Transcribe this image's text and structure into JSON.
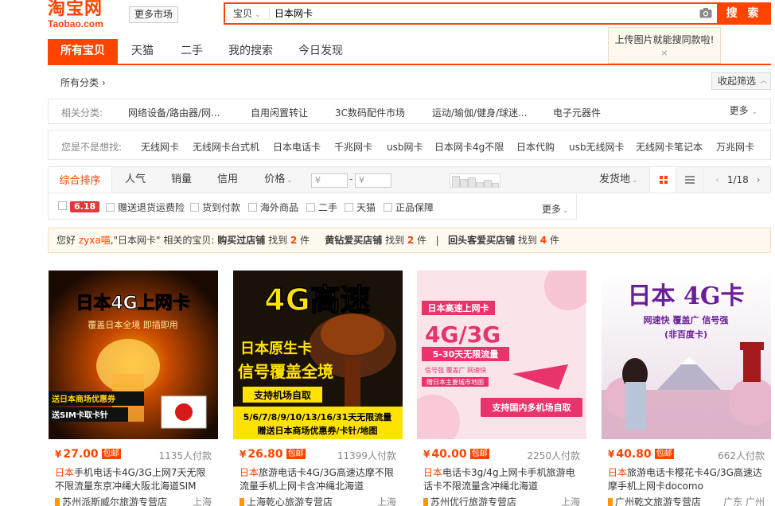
{
  "header": {
    "logo_cn": "淘宝网",
    "logo_en": "Taobao.com",
    "more_market": "更多市场",
    "search_type": "宝贝",
    "search_value": "日本网卡",
    "search_button": "搜 索",
    "tip_text": "上传图片就能搜同款啦!",
    "tip_close": "×"
  },
  "tabs": [
    "所有宝贝",
    "天猫",
    "二手",
    "我的搜索",
    "今日发现"
  ],
  "crumb": {
    "all_categories": "所有分类 ›",
    "collapse": "收起筛选"
  },
  "related": {
    "label": "相关分类:",
    "items": [
      "网络设备/路由器/网...",
      "自用闲置转让",
      "3C数码配件市场",
      "运动/瑜伽/健身/球迷...",
      "电子元器件"
    ],
    "more": "更多"
  },
  "suggest": {
    "label": "您是不是想找:",
    "items": [
      "无线网卡",
      "无线网卡台式机",
      "日本电话卡",
      "千兆网卡",
      "usb网卡",
      "日本网卡4g不限",
      "日本代购",
      "usb无线网卡",
      "无线网卡笔记本",
      "万兆网卡"
    ]
  },
  "sortbar": {
    "sorts": [
      "综合排序",
      "人气",
      "销量",
      "信用",
      "价格"
    ],
    "price_from": "¥",
    "price_to": "¥",
    "price_dash": "-",
    "ship_from": "发货地",
    "page": "1/18"
  },
  "filters": {
    "badge": "6.18",
    "items": [
      "赠送退货运费险",
      "货到付款",
      "海外商品",
      "二手",
      "天猫",
      "正品保障"
    ],
    "more": "更多"
  },
  "notice": {
    "hello": "您好",
    "nick": "zyxa喵",
    "p1": ",\"日本网卡\" 相关的宝贝:",
    "s1": "购买过店铺",
    "found": "找到",
    "c1": "2",
    "unit": "件",
    "s2": "黄钻爱买店铺",
    "c2": "2",
    "sep": "|",
    "s3": "回头客爱买店铺",
    "c3": "4"
  },
  "products": [
    {
      "price": "27.00",
      "yen": "¥",
      "tag": "包邮",
      "sold": "1135人付款",
      "title_hl": "日本",
      "title": "手机电话卡4G/3G上网7天无限不限流量东京冲绳大阪北海道SIM",
      "shop": "苏州派斯威尔旅游专营店",
      "loc": "上海",
      "pic": {
        "line1": "日本4G上网卡",
        "line2": "覆盖日本全境 即插即用",
        "line3": "送日本商场优惠券",
        "line4": "送SIM卡取卡针"
      }
    },
    {
      "price": "26.80",
      "yen": "¥",
      "tag": "包邮",
      "sold": "11399人付款",
      "title_hl": "日本",
      "title": "旅游电话卡4G/3G高速达摩不限流量手机上网卡含冲绳北海道",
      "shop": "上海乾心旅游专营店",
      "loc": "上海",
      "pic": {
        "line1": "4G高速",
        "line2": "日本原生卡",
        "line3": "信号覆盖全境",
        "line4": "支持机场自取",
        "line5": "5/6/7/8/9/10/13/16/31天无限流量",
        "line6": "赠送日本商场优惠券/卡针/地图"
      }
    },
    {
      "price": "40.00",
      "yen": "¥",
      "tag": "包邮",
      "sold": "2250人付款",
      "title_hl": "日本",
      "title": "电话卡3g/4g上网卡手机旅游电话卡不限流量含冲绳北海道",
      "shop": "苏州优行旅游专营店",
      "loc": "上海",
      "pic": {
        "line1": "日本高速上网卡",
        "line2": "4G/3G",
        "line3": "5-30天无限流量",
        "line4": "信号强 覆盖广 网速快",
        "line5": "赠日本主要城市地图",
        "line6": "支持国内多机场自取"
      }
    },
    {
      "price": "40.80",
      "yen": "¥",
      "tag": "包邮",
      "sold": "662人付款",
      "title_hl": "日本",
      "title": "旅游电话卡樱花卡4G/3G高速达摩手机上网卡docomo",
      "shop": "广州乾文旅游专营店",
      "loc": "广东 广州",
      "pic": {
        "line1": "日本 4G卡",
        "line2": "网速快 覆盖广 信号强",
        "line3": "(非百度卡)"
      }
    }
  ],
  "colors": {
    "accent": "#ff4400",
    "notice_bg": "#fff8ee"
  }
}
